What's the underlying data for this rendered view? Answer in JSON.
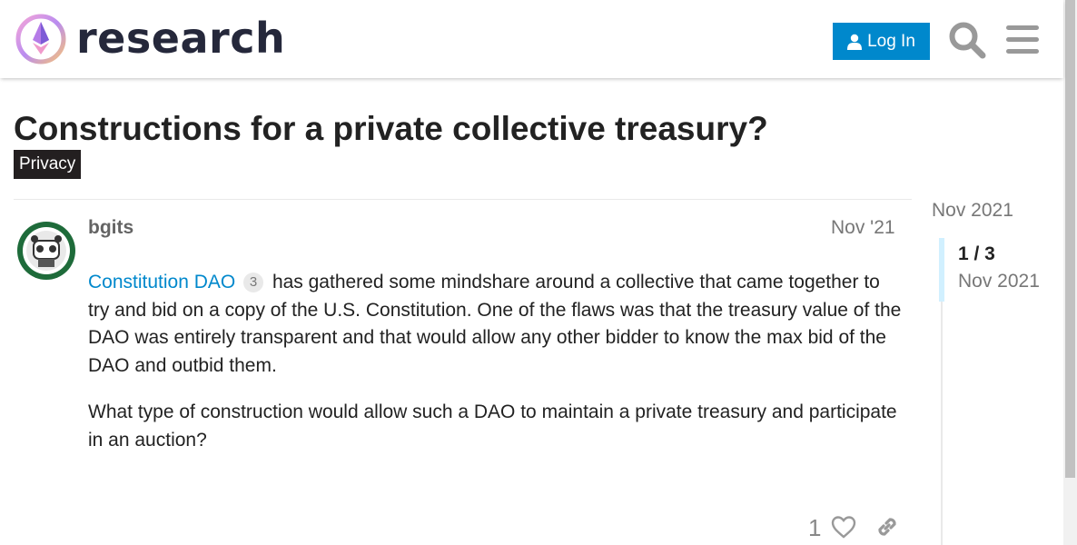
{
  "header": {
    "brand": "research",
    "login_label": "Log In",
    "icons": [
      "user-icon",
      "search-icon",
      "hamburger-menu-icon"
    ]
  },
  "topic": {
    "title": "Constructions for a private collective treasury?",
    "category": "Privacy",
    "category_color": "#231f20"
  },
  "post": {
    "username": "bgits",
    "date": "Nov '21",
    "link_text": "Constitution DAO",
    "link_clicks": "3",
    "paragraph1_rest": "has gathered some mindshare around a collective that came together to try and bid on a copy of the U.S. Constitution. One of the flaws was that the treasury value of the DAO was entirely transparent and that would allow any other bidder to know the max bid of the DAO and outbid them.",
    "paragraph2": "What type of construction would allow such a DAO to maintain a private treasury and participate in an auction?",
    "like_count": "1"
  },
  "timeline": {
    "start_date": "Nov 2021",
    "position": "1 / 3",
    "current_date": "Nov 2021"
  },
  "colors": {
    "accent": "#0088cc",
    "tertiary_light": "#d1f0ff",
    "muted": "#777777"
  }
}
